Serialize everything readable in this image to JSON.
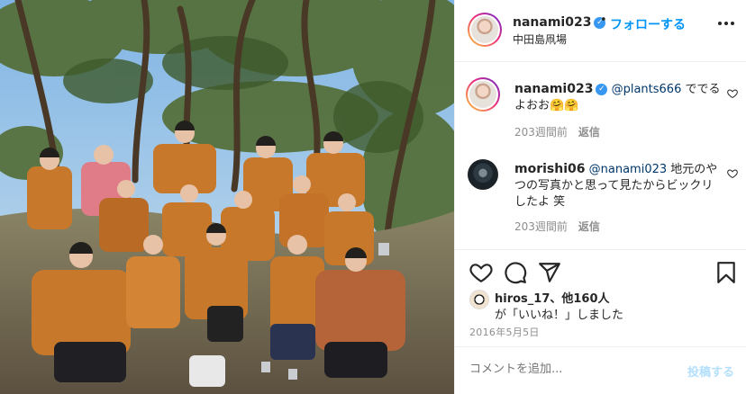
{
  "header": {
    "username": "nanami023",
    "separator": "•",
    "follow_label": "フォローする",
    "location": "中田島凧場"
  },
  "comments": [
    {
      "username": "nanami023",
      "mention": "@plants666",
      "text": " ででるよおお🤗🤗",
      "age": "203週間前",
      "reply_label": "返信"
    },
    {
      "username": "morishi06",
      "mention": "@nanami023",
      "text": " 地元のやつの写真かと思って見たからビックリしたよ 笑",
      "age": "203週間前",
      "reply_label": "返信"
    }
  ],
  "likes": {
    "line1_name": "hiros_17",
    "line1_suffix": "、他160人",
    "line2": "が「いいね！」しました"
  },
  "post_date": "2016年5月5日",
  "add_comment": {
    "placeholder": "コメントを追加...",
    "post_label": "投稿する"
  },
  "colors": {
    "accent": "#0095f6",
    "verified": "#3897f0",
    "post_disabled": "#b2dffc"
  }
}
